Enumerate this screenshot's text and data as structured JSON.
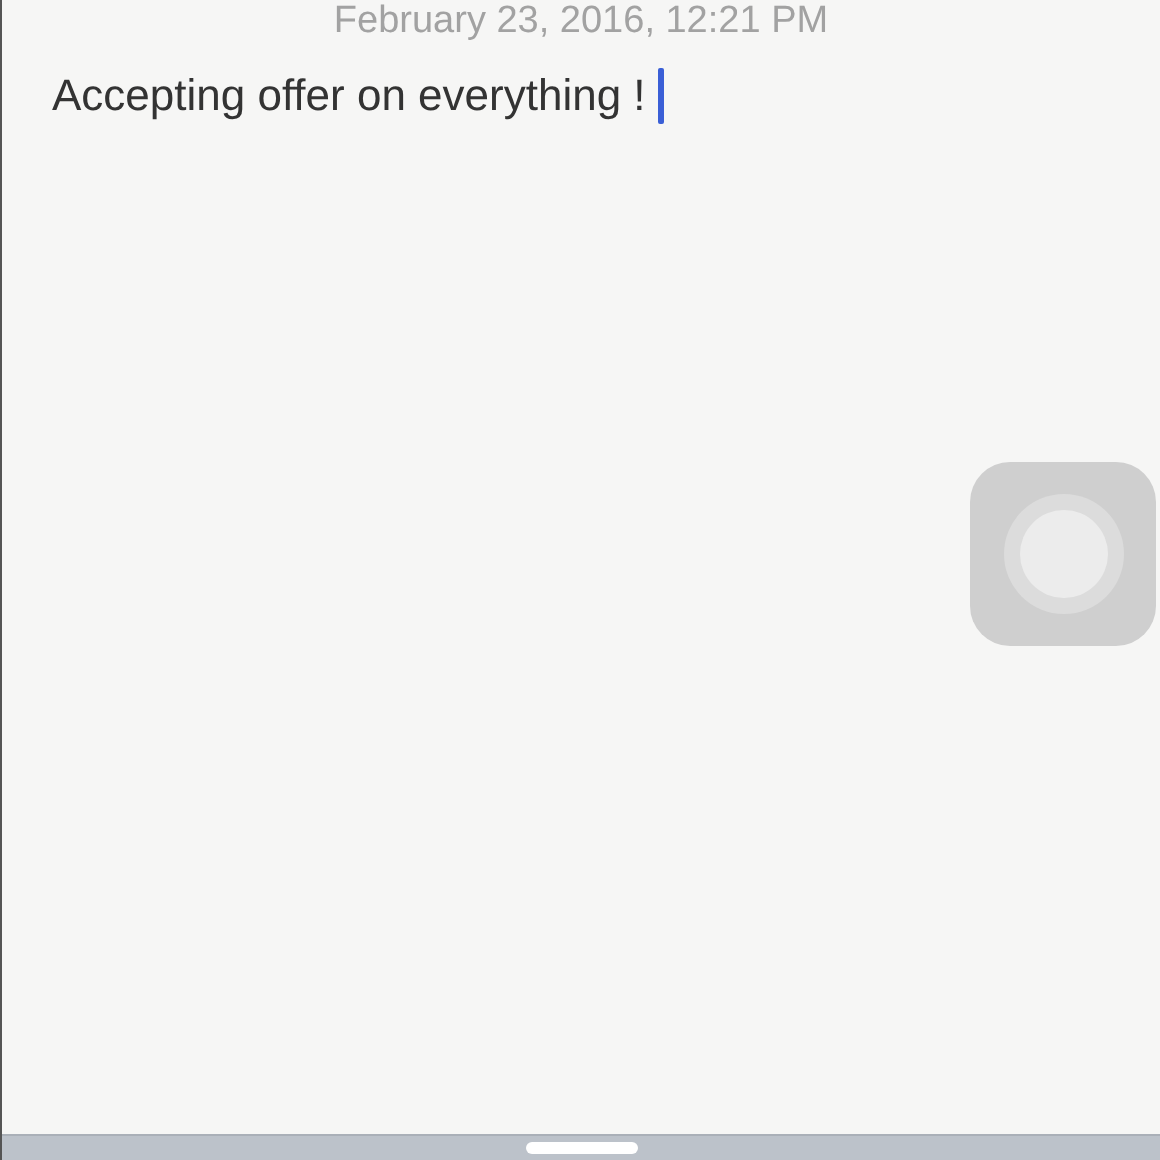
{
  "note": {
    "date": "February 23, 2016, 12:21 PM",
    "body": "Accepting offer on everything !"
  }
}
